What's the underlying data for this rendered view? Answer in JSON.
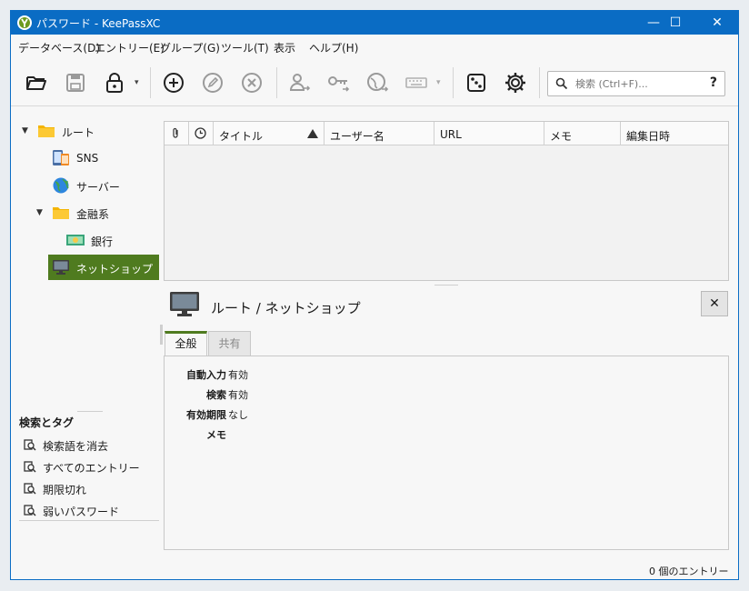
{
  "window": {
    "title": "パスワード - KeePassXC",
    "minimize": "—",
    "maximize": "☐",
    "close": "✕"
  },
  "menu": [
    "データベース(D)",
    "エントリー(E)",
    "グループ(G)",
    "ツール(T)",
    "表示",
    "ヘルプ(H)"
  ],
  "toolbar": {
    "icons": [
      "open-database-icon",
      "save-database-icon",
      "lock-icon",
      "add-entry-icon",
      "edit-entry-icon",
      "delete-entry-icon",
      "copy-username-icon",
      "copy-password-icon",
      "open-url-icon",
      "autotype-icon",
      "password-generator-icon",
      "settings-icon"
    ],
    "dropdown_glyph": "▾",
    "search_placeholder": "検索 (Ctrl+F)...",
    "search_help": "?"
  },
  "tree": {
    "expand_glyph": "▼",
    "items": [
      {
        "label": "ルート",
        "icon": "folder-icon"
      },
      {
        "label": "SNS",
        "icon": "phone-icon"
      },
      {
        "label": "サーバー",
        "icon": "globe-icon"
      },
      {
        "label": "金融系",
        "icon": "folder-icon"
      },
      {
        "label": "銀行",
        "icon": "money-icon"
      },
      {
        "label": "ネットショップ",
        "icon": "monitor-icon",
        "selected": true
      }
    ]
  },
  "tags": {
    "header": "検索とタグ",
    "items": [
      "検索語を消去",
      "すべてのエントリー",
      "期限切れ",
      "弱いパスワード"
    ]
  },
  "table": {
    "columns": [
      "",
      "",
      "タイトル",
      "ユーザー名",
      "URL",
      "メモ",
      "編集日時"
    ],
    "sort_column": "タイトル",
    "sort_direction": "ascending",
    "rows": []
  },
  "preview": {
    "title": "ルート / ネットショップ",
    "close": "✕",
    "tabs": [
      "全般",
      "共有"
    ],
    "details": [
      {
        "key": "自動入力",
        "value": "有効"
      },
      {
        "key": "検索",
        "value": "有効"
      },
      {
        "key": "有効期限",
        "value": "なし"
      },
      {
        "key": "メモ",
        "value": ""
      }
    ]
  },
  "status": "0 個のエントリー",
  "colors": {
    "titlebar": "#0a6cc4",
    "selection": "#4f7b1f",
    "folder": "#f4b400"
  }
}
